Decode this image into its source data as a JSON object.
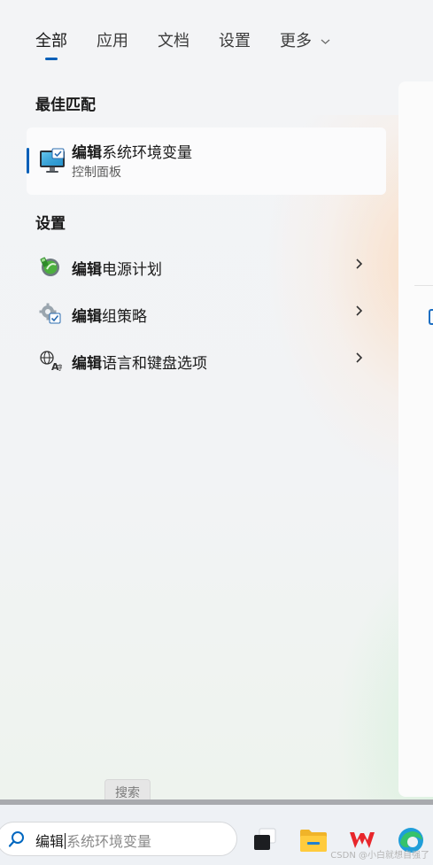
{
  "tabs": [
    {
      "label": "全部",
      "active": true
    },
    {
      "label": "应用",
      "active": false
    },
    {
      "label": "文档",
      "active": false
    },
    {
      "label": "设置",
      "active": false
    },
    {
      "label": "更多",
      "active": false
    }
  ],
  "best_match": {
    "section_title": "最佳匹配",
    "title_bold": "编辑",
    "title_rest": "系统环境变量",
    "subtitle": "控制面板",
    "icon": "monitor-settings-icon"
  },
  "settings_section": {
    "section_title": "设置",
    "items": [
      {
        "bold": "编辑",
        "rest": "电源计划",
        "icon": "power-plan-icon"
      },
      {
        "bold": "编辑",
        "rest": "组策略",
        "icon": "group-policy-icon"
      },
      {
        "bold": "编辑",
        "rest": "语言和键盘选项",
        "icon": "language-icon"
      }
    ]
  },
  "tooltip": {
    "label": "搜索"
  },
  "taskbar": {
    "search_typed": "编辑",
    "search_suggest": "系统环境变量"
  },
  "watermark": "CSDN @小白就想自强了",
  "colors": {
    "accent": "#005fb8"
  }
}
